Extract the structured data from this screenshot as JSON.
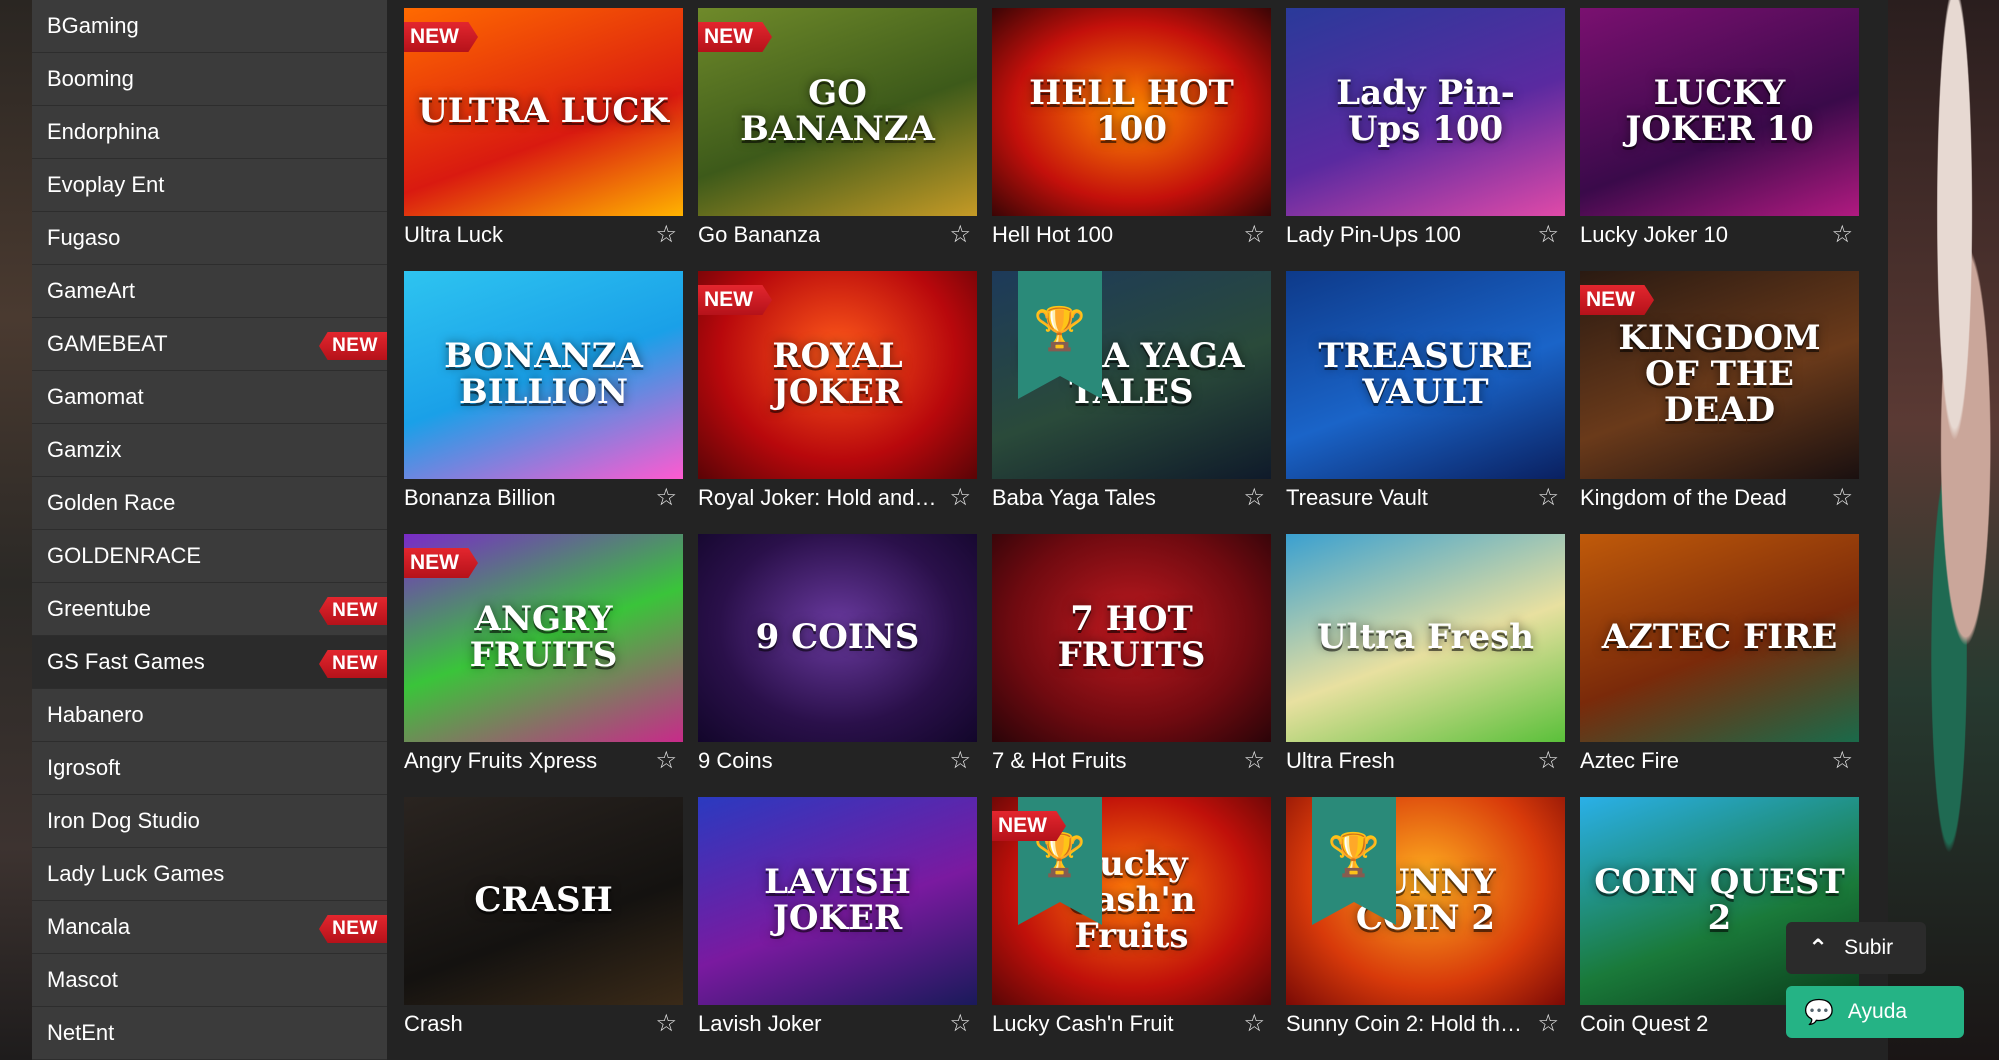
{
  "sidebar": {
    "new_label": "NEW",
    "providers": [
      {
        "label": "BGaming",
        "is_new": false,
        "active": false
      },
      {
        "label": "Booming",
        "is_new": false,
        "active": false
      },
      {
        "label": "Endorphina",
        "is_new": false,
        "active": false
      },
      {
        "label": "Evoplay Ent",
        "is_new": false,
        "active": false
      },
      {
        "label": "Fugaso",
        "is_new": false,
        "active": false
      },
      {
        "label": "GameArt",
        "is_new": false,
        "active": false
      },
      {
        "label": "GAMEBEAT",
        "is_new": true,
        "active": false
      },
      {
        "label": "Gamomat",
        "is_new": false,
        "active": false
      },
      {
        "label": "Gamzix",
        "is_new": false,
        "active": false
      },
      {
        "label": "Golden Race",
        "is_new": false,
        "active": false
      },
      {
        "label": "GOLDENRACE",
        "is_new": false,
        "active": false
      },
      {
        "label": "Greentube",
        "is_new": true,
        "active": false
      },
      {
        "label": "GS Fast Games",
        "is_new": true,
        "active": true
      },
      {
        "label": "Habanero",
        "is_new": false,
        "active": false
      },
      {
        "label": "Igrosoft",
        "is_new": false,
        "active": false
      },
      {
        "label": "Iron Dog Studio",
        "is_new": false,
        "active": false
      },
      {
        "label": "Lady Luck Games",
        "is_new": false,
        "active": false
      },
      {
        "label": "Mancala",
        "is_new": true,
        "active": false
      },
      {
        "label": "Mascot",
        "is_new": false,
        "active": false
      },
      {
        "label": "NetEnt",
        "is_new": false,
        "active": false
      }
    ]
  },
  "games": [
    {
      "title": "Ultra Luck",
      "art": "ULTRA LUCK",
      "is_new": true,
      "trophy": false,
      "bg": "linear-gradient(160deg,#ff6a00,#d91a10 60%,#ffb300)"
    },
    {
      "title": "Go Bananza",
      "art": "GO BANANZA",
      "is_new": true,
      "trophy": false,
      "bg": "linear-gradient(160deg,#6f8a2a,#3d5a1a 55%,#c59a26)"
    },
    {
      "title": "Hell Hot 100",
      "art": "HELL HOT 100",
      "is_new": false,
      "trophy": false,
      "bg": "radial-gradient(ellipse at 50% 50%,#ff8a00,#c4100b 60%,#3a0505)"
    },
    {
      "title": "Lady Pin-Ups 100",
      "art": "Lady Pin-Ups 100",
      "is_new": false,
      "trophy": false,
      "bg": "linear-gradient(160deg,#2a3a9a,#5a2aa0 55%,#e04aa8)"
    },
    {
      "title": "Lucky Joker 10",
      "art": "LUCKY JOKER 10",
      "is_new": false,
      "trophy": false,
      "bg": "linear-gradient(160deg,#7a1070,#3a0a4a 60%,#b01a80)"
    },
    {
      "title": "Bonanza Billion",
      "art": "BONANZA BILLION",
      "is_new": false,
      "trophy": false,
      "bg": "linear-gradient(160deg,#2ec4f0,#1aa0e8 50%,#ff5ad0)"
    },
    {
      "title": "Royal Joker: Hold and ...",
      "art": "ROYAL JOKER",
      "is_new": true,
      "trophy": false,
      "bg": "radial-gradient(ellipse at 50% 40%,#ff5a1a,#b8080c 60%,#5a0406)"
    },
    {
      "title": "Baba Yaga Tales",
      "art": "BABA YAGA TALES",
      "is_new": false,
      "trophy": true,
      "bg": "linear-gradient(160deg,#1d3a5a,#2a4a3a 55%,#0f1a2a)"
    },
    {
      "title": "Treasure Vault",
      "art": "TREASURE VAULT",
      "is_new": false,
      "trophy": false,
      "bg": "linear-gradient(160deg,#0e3a8a,#1a64c8 55%,#0a2060)"
    },
    {
      "title": "Kingdom of the Dead",
      "art": "KINGDOM OF THE DEAD",
      "is_new": true,
      "trophy": false,
      "bg": "linear-gradient(160deg,#2a1a12,#6a3a1a 55%,#1a1010)"
    },
    {
      "title": "Angry Fruits Xpress",
      "art": "ANGRY FRUITS",
      "is_new": true,
      "trophy": false,
      "bg": "linear-gradient(160deg,#7a2ac8,#3ac43a 50%,#c82a8a)"
    },
    {
      "title": "9 Coins",
      "art": "9 COINS",
      "is_new": false,
      "trophy": false,
      "bg": "radial-gradient(ellipse at 50% 45%,#6a3aa0,#2a104a 60%,#12062a)"
    },
    {
      "title": "7 & Hot Fruits",
      "art": "7 HOT FRUITS",
      "is_new": false,
      "trophy": false,
      "bg": "radial-gradient(ellipse at 50% 45%,#c01a20,#700a10 60%,#2a0408)"
    },
    {
      "title": "Ultra Fresh",
      "art": "Ultra Fresh",
      "is_new": false,
      "trophy": false,
      "bg": "linear-gradient(160deg,#3aa0d0,#e8e0a0 55%,#5ac03a)"
    },
    {
      "title": "Aztec Fire",
      "art": "AZTEC FIRE",
      "is_new": false,
      "trophy": false,
      "bg": "linear-gradient(160deg,#c05a0a,#7a2a0a 55%,#1a6a4a)"
    },
    {
      "title": "Crash",
      "art": "CRASH",
      "is_new": false,
      "trophy": false,
      "bg": "linear-gradient(160deg,#2a2420,#141210 60%,#3a2a18)"
    },
    {
      "title": "Lavish Joker",
      "art": "LAVISH JOKER",
      "is_new": false,
      "trophy": false,
      "bg": "linear-gradient(160deg,#2a3ac0,#7a1aa0 55%,#1a1a5a)"
    },
    {
      "title": "Lucky Cash'n Fruit",
      "art": "Lucky Cash'n Fruits",
      "is_new": true,
      "trophy": true,
      "bg": "radial-gradient(ellipse at 50% 45%,#ff7a0a,#c0100a 60%,#5a0606)"
    },
    {
      "title": "Sunny Coin 2: Hold the...",
      "art": "SUNNY COIN 2",
      "is_new": false,
      "trophy": true,
      "bg": "radial-gradient(ellipse at 50% 40%,#ffb020,#d83a0a 60%,#7a0a06)"
    },
    {
      "title": "Coin Quest 2",
      "art": "COIN QUEST 2",
      "is_new": false,
      "trophy": false,
      "bg": "linear-gradient(160deg,#2ab0e8,#1a7a3a 60%,#0a3a1a)"
    }
  ],
  "buttons": {
    "subir": "Subir",
    "ayuda": "Ayuda"
  },
  "icons": {
    "star": "star-outline-icon",
    "chevron": "chevron-up-icon",
    "chat": "chat-icon",
    "trophy": "trophy-icon"
  }
}
